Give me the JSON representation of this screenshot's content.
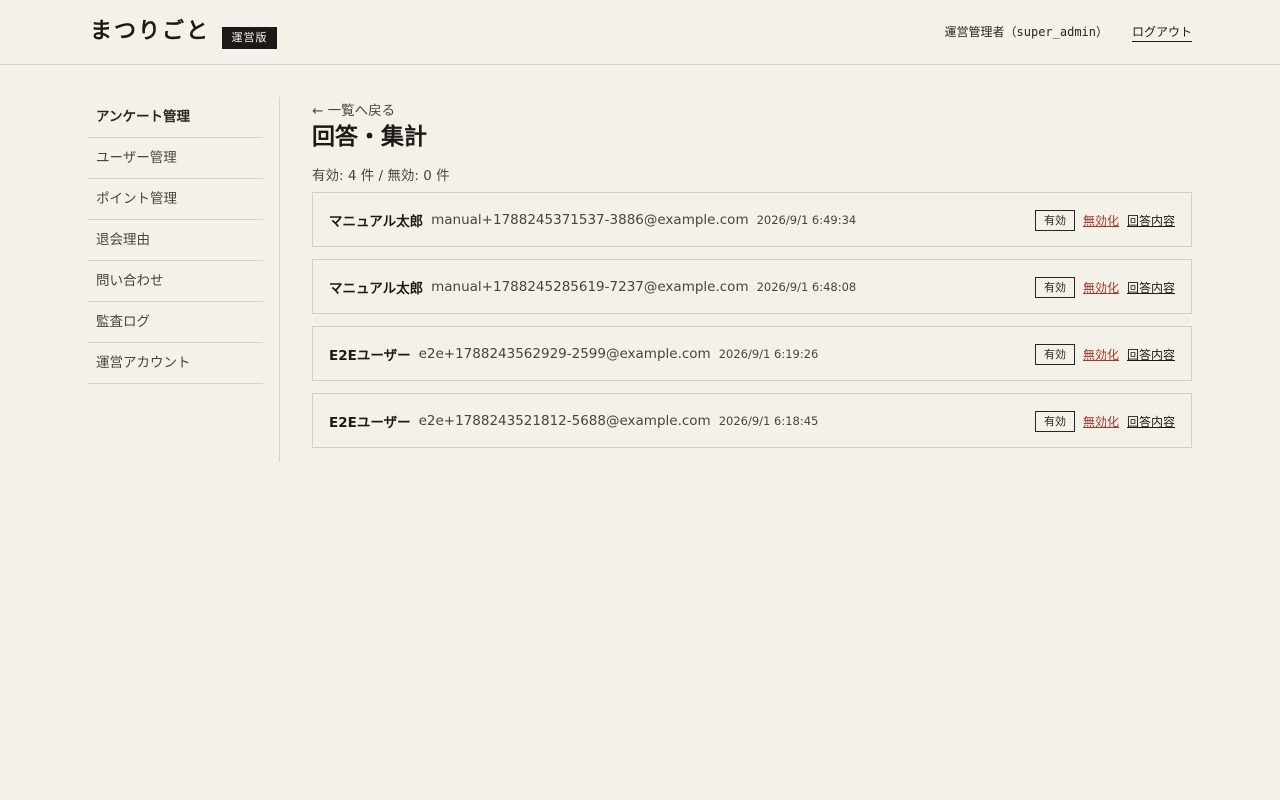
{
  "header": {
    "logo": "まつりごと",
    "edition_badge": "運営版",
    "user_info": "運営管理者（super_admin）",
    "logout": "ログアウト"
  },
  "sidebar": {
    "items": [
      {
        "label": "アンケート管理",
        "active": true
      },
      {
        "label": "ユーザー管理"
      },
      {
        "label": "ポイント管理"
      },
      {
        "label": "退会理由"
      },
      {
        "label": "問い合わせ"
      },
      {
        "label": "監査ログ"
      },
      {
        "label": "運営アカウント"
      }
    ]
  },
  "main": {
    "back_link": "← 一覧へ戻る",
    "title": "回答・集計",
    "summary": "有効: 4 件 / 無効: 0 件",
    "responses": [
      {
        "name": "マニュアル太郎",
        "email": "manual+1788245371537-3886@example.com",
        "datetime": "2026/9/1 6:49:34",
        "status": "有効",
        "disable": "無効化",
        "view": "回答内容"
      },
      {
        "name": "マニュアル太郎",
        "email": "manual+1788245285619-7237@example.com",
        "datetime": "2026/9/1 6:48:08",
        "status": "有効",
        "disable": "無効化",
        "view": "回答内容"
      },
      {
        "name": "E2Eユーザー",
        "email": "e2e+1788243562929-2599@example.com",
        "datetime": "2026/9/1 6:19:26",
        "status": "有効",
        "disable": "無効化",
        "view": "回答内容"
      },
      {
        "name": "E2Eユーザー",
        "email": "e2e+1788243521812-5688@example.com",
        "datetime": "2026/9/1 6:18:45",
        "status": "有効",
        "disable": "無効化",
        "view": "回答内容"
      }
    ]
  },
  "colors": {
    "background": "#f4f1e8",
    "border": "#d9d3c3",
    "text": "#2a2620",
    "danger": "#a3382c",
    "badge": "#1c1a16"
  }
}
